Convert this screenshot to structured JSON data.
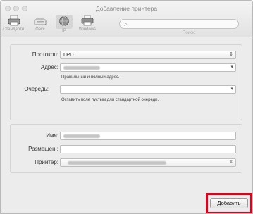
{
  "window": {
    "title": "Добавление принтера"
  },
  "toolbar": {
    "items": [
      {
        "label": "Стандартн."
      },
      {
        "label": "Факс"
      },
      {
        "label": "IP"
      },
      {
        "label": "Windows"
      }
    ],
    "search_label": "Поиск"
  },
  "form_top": {
    "protocol_label": "Протокол:",
    "protocol_value": "LPD",
    "address_label": "Адрес:",
    "address_hint": "Правильный и полный адрес.",
    "queue_label": "Очередь:",
    "queue_hint": "Оставить поле пустым для стандартной очереди."
  },
  "form_bottom": {
    "name_label": "Имя:",
    "location_label": "Размещен.:",
    "printer_label": "Принтер:"
  },
  "footer": {
    "add_button_label": "Добавить"
  },
  "colors": {
    "highlight": "#e4001b"
  }
}
